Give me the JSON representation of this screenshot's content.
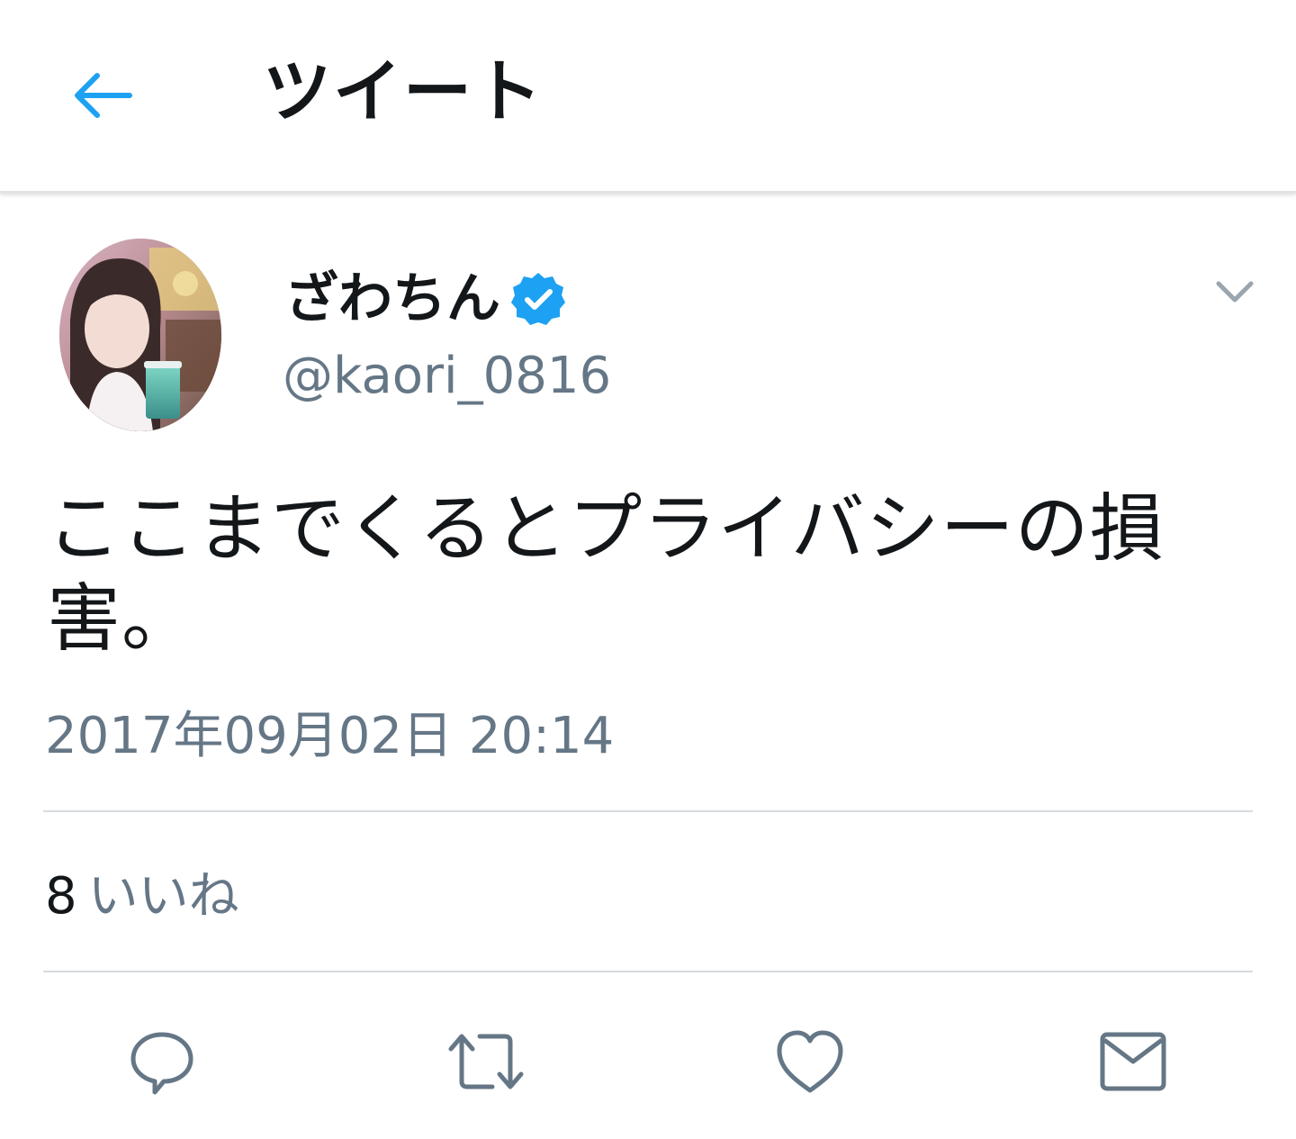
{
  "header": {
    "title": "ツイート",
    "back_icon": "arrow-left-icon",
    "accent_color": "#1da1f2"
  },
  "tweet": {
    "author": {
      "display_name": "ざわちん",
      "handle": "@kaori_0816",
      "verified": true
    },
    "text": "ここまでくるとプライバシーの損害。",
    "timestamp": "2017年09月02日 20:14",
    "stats": {
      "likes_count": "8",
      "likes_label": "いいね"
    }
  },
  "actions": [
    {
      "name": "reply",
      "icon": "reply-icon"
    },
    {
      "name": "retweet",
      "icon": "retweet-icon"
    },
    {
      "name": "like",
      "icon": "heart-icon"
    },
    {
      "name": "share",
      "icon": "envelope-icon"
    }
  ],
  "colors": {
    "text_primary": "#14171a",
    "text_secondary": "#657786",
    "icon_gray": "#657786",
    "divider": "#d6dbdf"
  }
}
